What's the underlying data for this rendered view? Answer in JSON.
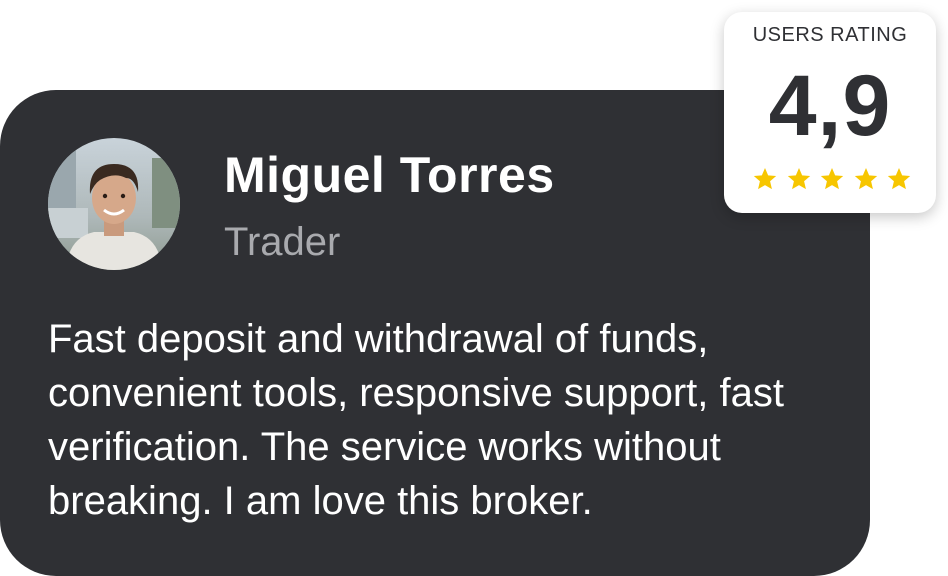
{
  "review": {
    "name": "Miguel Torres",
    "role": "Trader",
    "text": "Fast deposit and withdrawal of funds, convenient tools, responsive support, fast verification. The service works without breaking. I am love this broker."
  },
  "rating": {
    "label": "USERS RATING",
    "value": "4,9",
    "stars": 5,
    "star_color": "#f7c600"
  },
  "colors": {
    "card_background": "#2f3034",
    "secondary_text": "#a9aaae"
  }
}
